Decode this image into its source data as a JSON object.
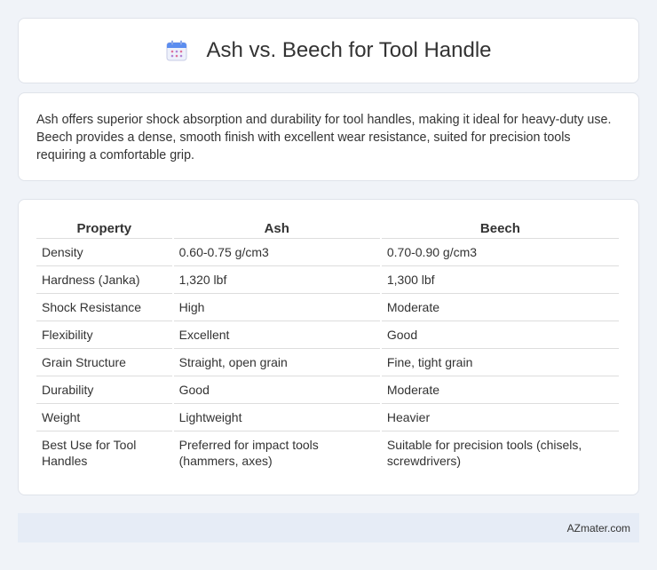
{
  "header": {
    "icon": "calendar-icon",
    "title": "Ash vs. Beech for Tool Handle"
  },
  "intro": {
    "text": "Ash offers superior shock absorption and durability for tool handles, making it ideal for heavy-duty use. Beech provides a dense, smooth finish with excellent wear resistance, suited for precision tools requiring a comfortable grip."
  },
  "table": {
    "headers": [
      "Property",
      "Ash",
      "Beech"
    ],
    "rows": [
      [
        "Density",
        "0.60-0.75 g/cm3",
        "0.70-0.90 g/cm3"
      ],
      [
        "Hardness (Janka)",
        "1,320 lbf",
        "1,300 lbf"
      ],
      [
        "Shock Resistance",
        "High",
        "Moderate"
      ],
      [
        "Flexibility",
        "Excellent",
        "Good"
      ],
      [
        "Grain Structure",
        "Straight, open grain",
        "Fine, tight grain"
      ],
      [
        "Durability",
        "Good",
        "Moderate"
      ],
      [
        "Weight",
        "Lightweight",
        "Heavier"
      ],
      [
        "Best Use for Tool Handles",
        "Preferred for impact tools (hammers, axes)",
        "Suitable for precision tools (chisels, screwdrivers)"
      ]
    ]
  },
  "footer": {
    "text": "AZmater.com"
  },
  "colors": {
    "background": "#f0f3f8",
    "card": "#ffffff",
    "footer_bg": "#e6ecf6"
  }
}
